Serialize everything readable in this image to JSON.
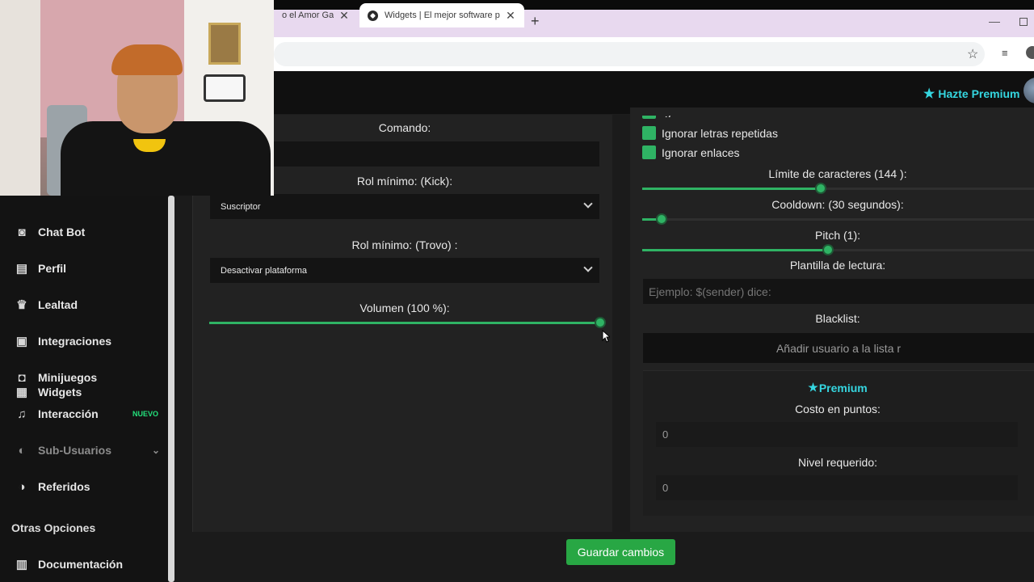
{
  "browser": {
    "tabs": [
      {
        "title": "o el Amor Gay e",
        "close": "✕"
      },
      {
        "title": "Widgets | El mejor software par",
        "close": "✕"
      }
    ],
    "new_tab": "+"
  },
  "header": {
    "premium_label": "Hazte Premium"
  },
  "sidebar": {
    "items": [
      {
        "label": "Widgets",
        "icon": "widgets-icon"
      },
      {
        "label": "Chat Bot",
        "icon": "robot-icon"
      },
      {
        "label": "Perfil",
        "icon": "id-card-icon"
      },
      {
        "label": "Lealtad",
        "icon": "trophy-icon"
      },
      {
        "label": "Integraciones",
        "icon": "integrations-icon"
      },
      {
        "label": "Minijuegos",
        "icon": "gamepad-icon"
      },
      {
        "label": "Interacción",
        "icon": "music-icon",
        "badge": "NUEVO"
      },
      {
        "label": "Sub-Usuarios",
        "icon": "users-icon",
        "disabled": true
      },
      {
        "label": "Referidos",
        "icon": "referrals-icon"
      }
    ],
    "section_title": "Otras Opciones",
    "extra_items": [
      {
        "label": "Documentación",
        "icon": "docs-icon"
      }
    ]
  },
  "left_panel": {
    "command_label": "Comando:",
    "command_value": "",
    "kick_role_label": "Rol mínimo: (Kick):",
    "kick_role_value": "Suscriptor",
    "trovo_role_label": "Rol mínimo: (Trovo) :",
    "trovo_role_value": "Desactivar plataforma",
    "volume_label": "Volumen (100 %):",
    "volume_value": 1.0
  },
  "right_panel": {
    "checkboxes": [
      {
        "label": "Ignorar emoticones",
        "checked": true
      },
      {
        "label": "Ignorar letras repetidas",
        "checked": true
      },
      {
        "label": "Ignorar enlaces",
        "checked": true
      }
    ],
    "char_limit_label": "Límite de caracteres (144 ):",
    "char_limit_value": 0.455,
    "cooldown_label": "Cooldown: (30 segundos):",
    "cooldown_value": 0.05,
    "pitch_label": "Pitch (1):",
    "pitch_value": 0.475,
    "template_label": "Plantilla de lectura:",
    "template_placeholder": "Ejemplo: $(sender) dice:",
    "blacklist_label": "Blacklist:",
    "blacklist_placeholder": "Añadir usuario a la lista r",
    "premium_title": "Premium",
    "cost_label": "Costo en puntos:",
    "cost_value": "0",
    "level_label": "Nivel requerido:",
    "level_value": "0"
  },
  "actions": {
    "save_label": "Guardar cambios"
  },
  "colors": {
    "accent_green": "#2fb364",
    "premium_cyan": "#35d6e0",
    "save_button": "#28a744"
  }
}
